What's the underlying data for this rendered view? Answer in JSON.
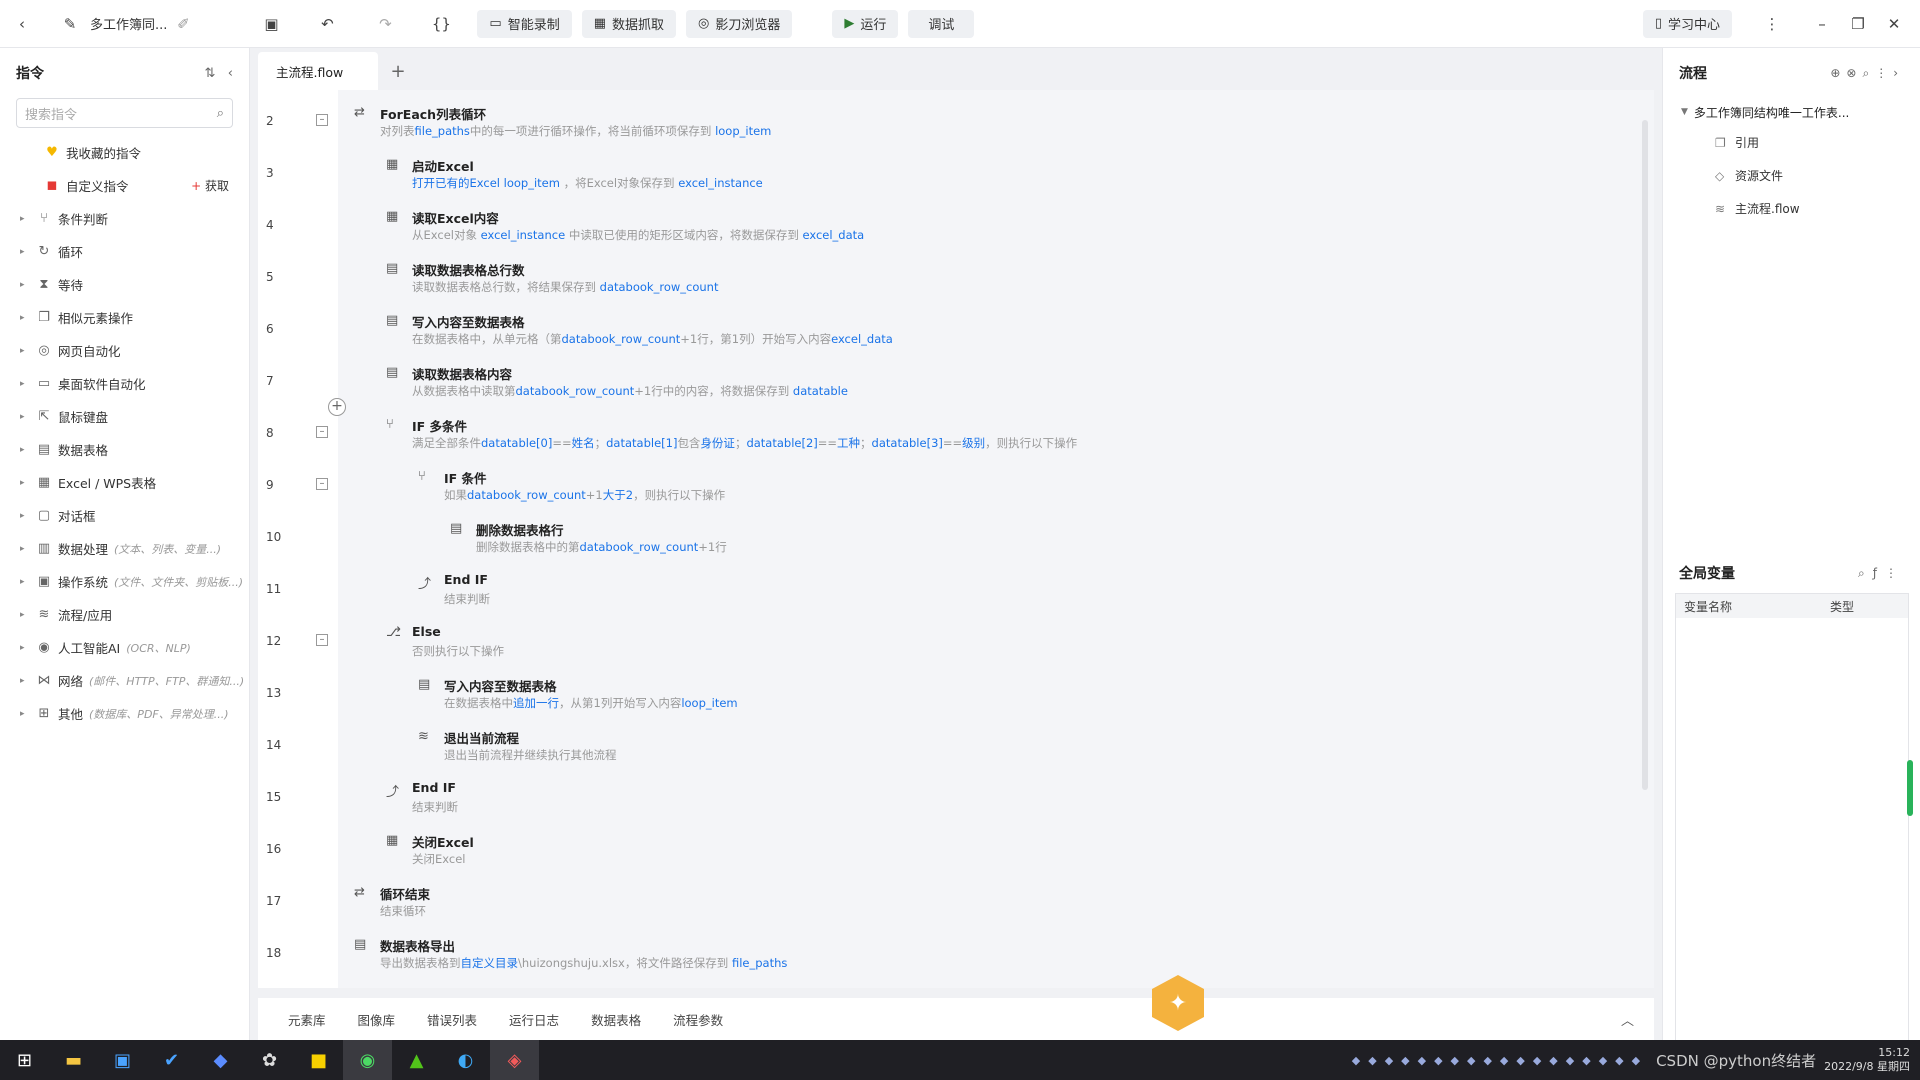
{
  "topbar": {
    "project_title": "多工作簿同...",
    "smart_record": "智能录制",
    "data_capture": "数据抓取",
    "browser": "影刀浏览器",
    "run": "运行",
    "debug": "调试",
    "learn_center": "学习中心"
  },
  "left_panel": {
    "title": "指令",
    "search_placeholder": "搜索指令",
    "items": [
      {
        "label": "我收藏的指令",
        "icon": "heart-icon",
        "hint": "",
        "expandable": false
      },
      {
        "label": "自定义指令",
        "icon": "custom-icon",
        "hint": "",
        "expandable": false,
        "get_label": "获取"
      },
      {
        "label": "条件判断",
        "icon": "branch-icon",
        "hint": "",
        "expandable": true
      },
      {
        "label": "循环",
        "icon": "loop-icon",
        "hint": "",
        "expandable": true
      },
      {
        "label": "等待",
        "icon": "hourglass-icon",
        "hint": "",
        "expandable": true
      },
      {
        "label": "相似元素操作",
        "icon": "copy-icon",
        "hint": "",
        "expandable": true
      },
      {
        "label": "网页自动化",
        "icon": "globe-icon",
        "hint": "",
        "expandable": true
      },
      {
        "label": "桌面软件自动化",
        "icon": "monitor-icon",
        "hint": "",
        "expandable": true
      },
      {
        "label": "鼠标键盘",
        "icon": "mouse-icon",
        "hint": "",
        "expandable": true
      },
      {
        "label": "数据表格",
        "icon": "table-icon",
        "hint": "",
        "expandable": true
      },
      {
        "label": "Excel / WPS表格",
        "icon": "excel-icon",
        "hint": "",
        "expandable": true
      },
      {
        "label": "对话框",
        "icon": "dialog-icon",
        "hint": "",
        "expandable": true
      },
      {
        "label": "数据处理",
        "icon": "data-icon",
        "hint": "(文本、列表、变量...)",
        "expandable": true
      },
      {
        "label": "操作系统",
        "icon": "os-icon",
        "hint": "(文件、文件夹、剪贴板...)",
        "expandable": true
      },
      {
        "label": "流程/应用",
        "icon": "layers-icon",
        "hint": "",
        "expandable": true
      },
      {
        "label": "人工智能AI",
        "icon": "ai-icon",
        "hint": "(OCR、NLP)",
        "expandable": true
      },
      {
        "label": "网络",
        "icon": "network-icon",
        "hint": "(邮件、HTTP、FTP、群通知...)",
        "expandable": true
      },
      {
        "label": "其他",
        "icon": "grid-icon",
        "hint": "(数据库、PDF、异常处理...)",
        "expandable": true
      }
    ]
  },
  "tabs": [
    {
      "label": "主流程.flow"
    }
  ],
  "lines": [
    {
      "n": "2",
      "indent": 0,
      "title": "ForEach列表循环",
      "desc": "对列表file_paths中的每一项进行循环操作，将当前循环项保存到 loop_item",
      "fold": true
    },
    {
      "n": "3",
      "indent": 1,
      "title": "启动Excel",
      "desc": "打开已有的Excel  loop_item ，将Excel对象保存到 excel_instance",
      "fold": false
    },
    {
      "n": "4",
      "indent": 1,
      "title": "读取Excel内容",
      "desc": "从Excel对象 excel_instance 中读取已使用的矩形区域内容，将数据保存到 excel_data",
      "fold": false
    },
    {
      "n": "5",
      "indent": 1,
      "title": "读取数据表格总行数",
      "desc": "读取数据表格总行数，将结果保存到 databook_row_count",
      "fold": false
    },
    {
      "n": "6",
      "indent": 1,
      "title": "写入内容至数据表格",
      "desc": "在数据表格中，从单元格（第databook_row_count+1行，第1列）开始写入内容excel_data",
      "fold": false
    },
    {
      "n": "7",
      "indent": 1,
      "title": "读取数据表格内容",
      "desc": "从数据表格中读取第databook_row_count+1行中的内容，将数据保存到 datatable",
      "fold": false
    },
    {
      "n": "8",
      "indent": 1,
      "title": "IF 多条件",
      "desc": "满足全部条件datatable[0]==姓名；datatable[1]包含身份证；datatable[2]==工种；datatable[3]==级别，则执行以下操作",
      "fold": true
    },
    {
      "n": "9",
      "indent": 2,
      "title": "IF 条件",
      "desc": "如果databook_row_count+1大于2，则执行以下操作",
      "fold": true
    },
    {
      "n": "10",
      "indent": 3,
      "title": "删除数据表格行",
      "desc": "删除数据表格中的第databook_row_count+1行",
      "fold": false
    },
    {
      "n": "11",
      "indent": 2,
      "title": "End IF",
      "desc": "结束判断",
      "fold": false
    },
    {
      "n": "12",
      "indent": 1,
      "title": "Else",
      "desc": "否则执行以下操作",
      "fold": true
    },
    {
      "n": "13",
      "indent": 2,
      "title": "写入内容至数据表格",
      "desc": "在数据表格中追加一行，从第1列开始写入内容loop_item",
      "fold": false
    },
    {
      "n": "14",
      "indent": 2,
      "title": "退出当前流程",
      "desc": "退出当前流程并继续执行其他流程",
      "fold": false
    },
    {
      "n": "15",
      "indent": 1,
      "title": "End IF",
      "desc": "结束判断",
      "fold": false
    },
    {
      "n": "16",
      "indent": 1,
      "title": "关闭Excel",
      "desc": "关闭Excel",
      "fold": false
    },
    {
      "n": "17",
      "indent": 0,
      "title": "循环结束",
      "desc": "结束循环",
      "fold": false
    },
    {
      "n": "18",
      "indent": 0,
      "title": "数据表格导出",
      "desc": "导出数据表格到自定义目录\\huizongshuju.xlsx，将文件路径保存到 file_paths",
      "fold": false
    }
  ],
  "bottom_tabs": [
    "元素库",
    "图像库",
    "错误列表",
    "运行日志",
    "数据表格",
    "流程参数"
  ],
  "right_panel": {
    "title": "流程",
    "root": "多工作簿同结构唯一工作表...",
    "items": [
      {
        "label": "引用",
        "icon": "reference-icon"
      },
      {
        "label": "资源文件",
        "icon": "resource-icon"
      },
      {
        "label": "主流程.flow",
        "icon": "flow-icon"
      }
    ]
  },
  "global_vars": {
    "title": "全局变量",
    "col_name": "变量名称",
    "col_type": "类型"
  },
  "taskbar": {
    "time": "15:12",
    "date": "2022/9/8 星期四",
    "tray_text": "CSDN @python终结者"
  }
}
